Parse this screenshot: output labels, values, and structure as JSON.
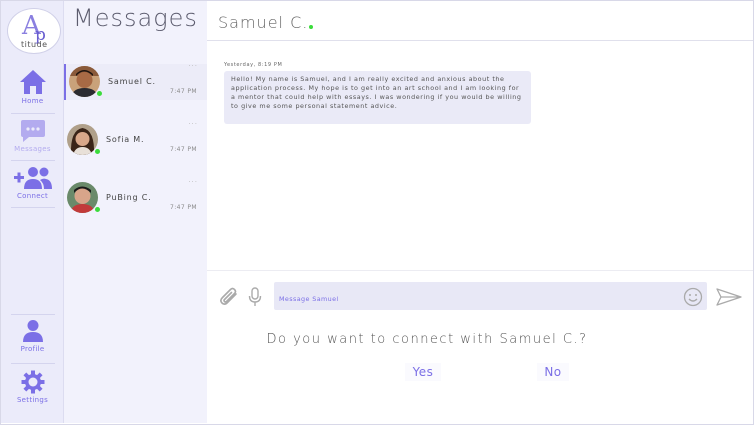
{
  "app": {
    "logo_text": "titude",
    "logo_letter_a": "A",
    "logo_letter_p": "p"
  },
  "nav": {
    "items": [
      {
        "label": "Home",
        "icon": "home-icon"
      },
      {
        "label": "Messages",
        "icon": "chat-icon"
      },
      {
        "label": "Connect",
        "icon": "add-user-icon"
      },
      {
        "label": "Profile",
        "icon": "person-icon"
      },
      {
        "label": "Settings",
        "icon": "gear-icon"
      }
    ]
  },
  "list": {
    "title": "Messages",
    "conversations": [
      {
        "name": "Samuel C.",
        "time": "7:47 PM",
        "more": "...",
        "online": true
      },
      {
        "name": "Sofia M.",
        "time": "7:47 PM",
        "more": "...",
        "online": true
      },
      {
        "name": "PuBing C.",
        "time": "7:47 PM",
        "more": "...",
        "online": true
      }
    ]
  },
  "chat": {
    "title": "Samuel C.",
    "timestamp": "Yesterday, 8:19 PM",
    "message": "Hello! My name is Samuel, and I am really excited and anxious about the application process. My hope is to get into an art school and I am looking for a mentor that could help with essays. I was wondering if you would be willing to give me some personal statement advice.",
    "input_placeholder": "Message Samuel",
    "connect_question": "Do you want to connect with Samuel C.?",
    "yes_label": "Yes",
    "no_label": "No"
  },
  "colors": {
    "accent": "#7b6fe6",
    "nav_bg": "#ebebfa",
    "list_bg": "#f2f2fc",
    "online": "#3bdc3b"
  }
}
